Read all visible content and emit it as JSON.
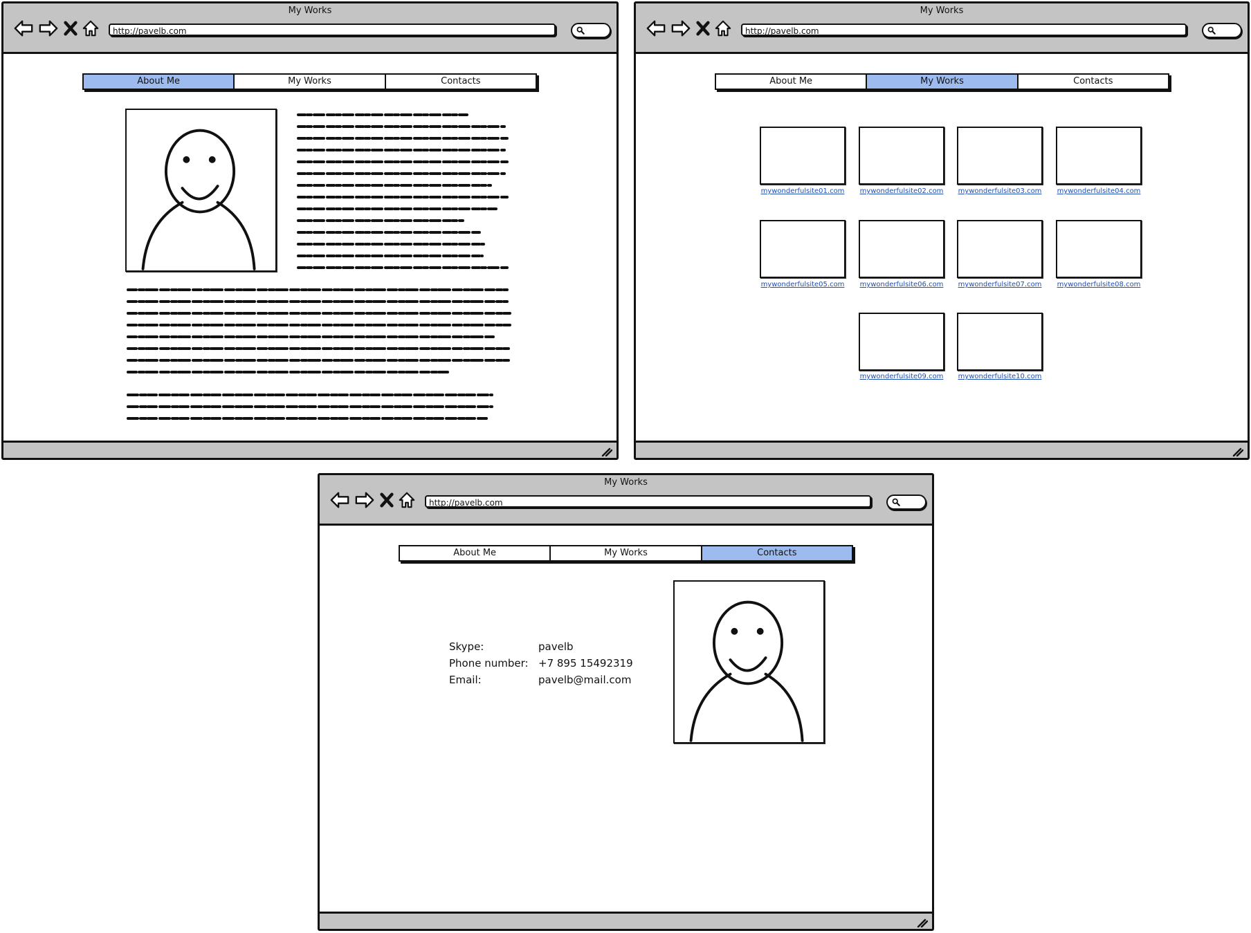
{
  "windows": [
    {
      "title": "My Works",
      "url": "http://pavelb.com",
      "tabs": [
        {
          "label": "About Me",
          "active": true
        },
        {
          "label": "My Works",
          "active": false
        },
        {
          "label": "Contacts",
          "active": false
        }
      ]
    },
    {
      "title": "My Works",
      "url": "http://pavelb.com",
      "tabs": [
        {
          "label": "About Me",
          "active": false
        },
        {
          "label": "My Works",
          "active": true
        },
        {
          "label": "Contacts",
          "active": false
        }
      ],
      "works": [
        "mywonderfulsite01.com",
        "mywonderfulsite02.com",
        "mywonderfulsite03.com",
        "mywonderfulsite04.com",
        "mywonderfulsite05.com",
        "mywonderfulsite06.com",
        "mywonderfulsite07.com",
        "mywonderfulsite08.com",
        "mywonderfulsite09.com",
        "mywonderfulsite10.com"
      ]
    },
    {
      "title": "My Works",
      "url": "http://pavelb.com",
      "tabs": [
        {
          "label": "About Me",
          "active": false
        },
        {
          "label": "My Works",
          "active": false
        },
        {
          "label": "Contacts",
          "active": true
        }
      ],
      "contacts": [
        {
          "label": "Skype:",
          "value": "pavelb"
        },
        {
          "label": "Phone number:",
          "value": "+7 895 15492319"
        },
        {
          "label": "Email:",
          "value": "pavelb@mail.com"
        }
      ]
    }
  ],
  "colors": {
    "chrome_gray": "#c4c4c4",
    "active_tab": "#9dbbef",
    "link": "#1f4fb3"
  },
  "icons": [
    "back-arrow-icon",
    "forward-arrow-icon",
    "stop-icon",
    "home-icon",
    "search-icon",
    "resize-grip-icon",
    "avatar-placeholder-icon"
  ]
}
